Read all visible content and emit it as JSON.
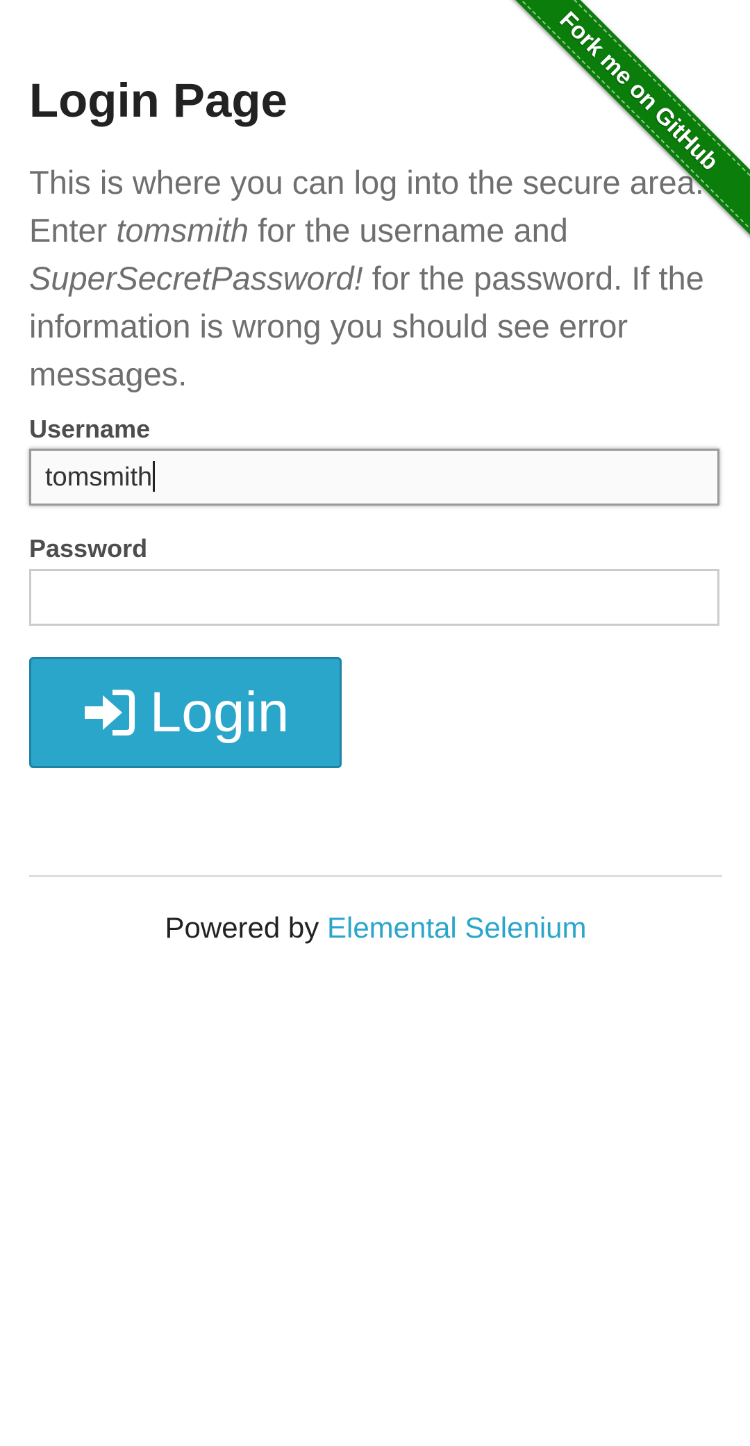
{
  "header": {
    "title": "Login Page"
  },
  "intro": {
    "line1": "This is where you can log into the secure area.",
    "line2_prefix": "Enter ",
    "username_hint": "tomsmith",
    "line2_suffix": " for the username and",
    "password_hint": "SuperSecretPassword!",
    "line3_suffix": " for the password. If the",
    "line4": "information is wrong you should see error",
    "line5": "messages."
  },
  "form": {
    "username_label": "Username",
    "username_value": "tomsmith",
    "password_label": "Password",
    "password_value": "",
    "login_label": "Login",
    "login_icon": "sign-in-icon"
  },
  "footer": {
    "prefix": "Powered by ",
    "link_text": "Elemental Selenium"
  },
  "ribbon": {
    "text": "Fork me on GitHub",
    "color": "#0a7d0a"
  },
  "colors": {
    "accent": "#2ba6cb",
    "title": "#222222",
    "intro_text": "#6f6f6f"
  }
}
